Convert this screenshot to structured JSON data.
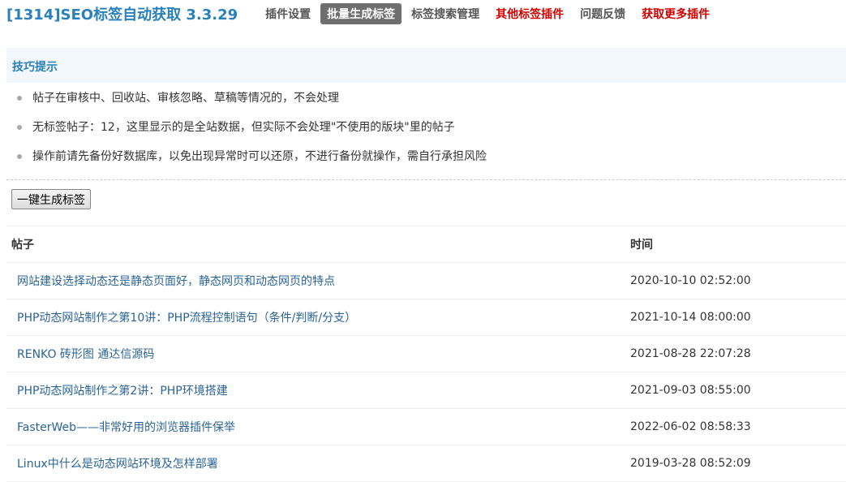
{
  "app": {
    "title": "[1314]SEO标签自动获取 3.3.29"
  },
  "nav": {
    "items": [
      {
        "label": "插件设置",
        "active": false,
        "red": false
      },
      {
        "label": "批量生成标签",
        "active": true,
        "red": false
      },
      {
        "label": "标签搜索管理",
        "active": false,
        "red": false
      },
      {
        "label": "其他标签插件",
        "active": false,
        "red": true
      },
      {
        "label": "问题反馈",
        "active": false,
        "red": false
      },
      {
        "label": "获取更多插件",
        "active": false,
        "red": true
      }
    ]
  },
  "tips": {
    "title": "技巧提示",
    "items": [
      "帖子在审核中、回收站、审核忽略、草稿等情况的，不会处理",
      "无标签帖子：12，这里显示的是全站数据，但实际不会处理\"不使用的版块\"里的帖子",
      "操作前请先备份好数据库，以免出现异常时可以还原，不进行备份就操作，需自行承担风险"
    ]
  },
  "actions": {
    "generate_label": "一键生成标签"
  },
  "table": {
    "headers": {
      "post": "帖子",
      "time": "时间"
    },
    "rows": [
      {
        "title": "网站建设选择动态还是静态页面好，静态网页和动态网页的特点",
        "time": "2020-10-10 02:52:00"
      },
      {
        "title": "PHP动态网站制作之第10讲：PHP流程控制语句（条件/判断/分支）",
        "time": "2021-10-14 08:00:00"
      },
      {
        "title": "RENKO 砖形图 通达信源码",
        "time": "2021-08-28 22:07:28"
      },
      {
        "title": "PHP动态网站制作之第2讲：PHP环境搭建",
        "time": "2021-09-03 08:55:00"
      },
      {
        "title": "FasterWeb——非常好用的浏览器插件保举",
        "time": "2022-06-02 08:58:33"
      },
      {
        "title": "Linux中什么是动态网站环境及怎样部署",
        "time": "2019-03-28 08:52:09"
      }
    ]
  },
  "colors": {
    "accent": "#2a80b9",
    "link": "#2a6496",
    "red": "#d00000",
    "active_tab_bg": "#6f6f6f",
    "tips_bg": "#f2f7fc"
  }
}
